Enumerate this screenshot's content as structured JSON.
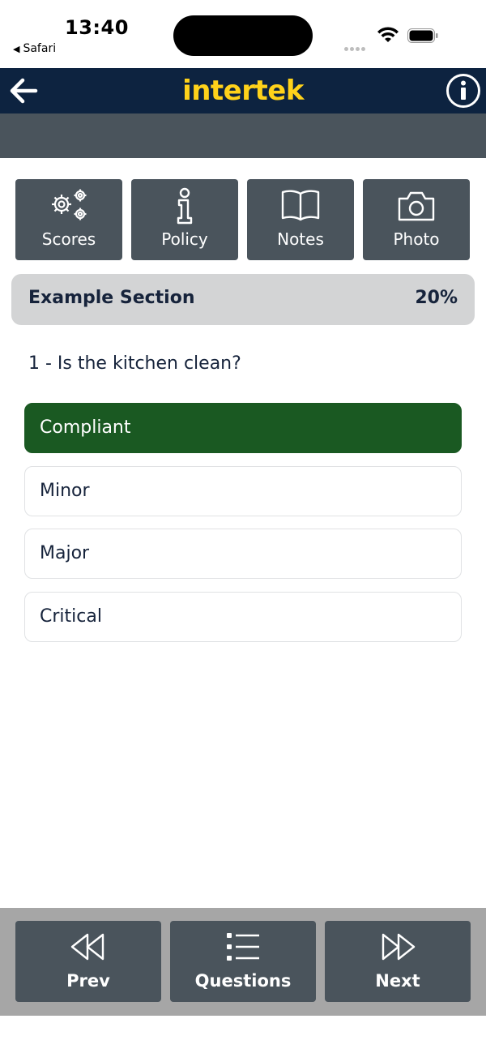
{
  "status": {
    "time": "13:40",
    "back_app": "Safari"
  },
  "header": {
    "logo_text": "intertek"
  },
  "toolbar": {
    "scores_label": "Scores",
    "policy_label": "Policy",
    "notes_label": "Notes",
    "photo_label": "Photo"
  },
  "section": {
    "title": "Example Section",
    "progress": "20%"
  },
  "question": {
    "text": "1 - Is the kitchen clean?"
  },
  "answers": [
    {
      "label": "Compliant",
      "selected": true
    },
    {
      "label": "Minor",
      "selected": false
    },
    {
      "label": "Major",
      "selected": false
    },
    {
      "label": "Critical",
      "selected": false
    }
  ],
  "bottom_nav": {
    "prev_label": "Prev",
    "questions_label": "Questions",
    "next_label": "Next"
  },
  "colors": {
    "header_bg": "#0d2340",
    "logo": "#ffd21a",
    "button_bg": "#4a545c",
    "selected_answer": "#1a5922"
  }
}
